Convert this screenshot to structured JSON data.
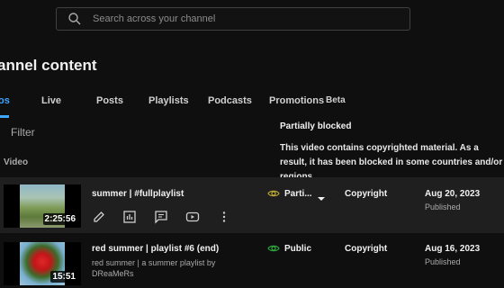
{
  "search": {
    "placeholder": "Search across your channel"
  },
  "page": {
    "title": "annel content"
  },
  "tabs": [
    {
      "label": "os"
    },
    {
      "label": "Live"
    },
    {
      "label": "Posts"
    },
    {
      "label": "Playlists"
    },
    {
      "label": "Podcasts"
    },
    {
      "label": "Promotions"
    }
  ],
  "beta_badge": "Beta",
  "filter": {
    "label": "Filter"
  },
  "columns": {
    "video": "Video"
  },
  "tooltip": {
    "title": "Partially blocked",
    "body": "This video contains copyrighted material. As a result, it has been blocked in some countries and/or regions."
  },
  "rows": [
    {
      "title": "summer | #fullplaylist",
      "duration": "2:25:56",
      "visibility": "Parti...",
      "restriction": "Copyright",
      "date": "Aug 20, 2023",
      "date_status": "Published",
      "visibility_icon": "eye-icon",
      "visibility_color": "#b8a633"
    },
    {
      "title": "red summer | playlist #6 (end)",
      "description": "red summer | a summer playlist by DReaMeRs —————————————————————/——",
      "duration": "15:51",
      "visibility": "Public",
      "restriction": "Copyright",
      "date": "Aug 16, 2023",
      "date_status": "Published",
      "visibility_icon": "eye-icon",
      "visibility_color": "#2ba640"
    }
  ],
  "row_actions": [
    "edit-icon",
    "analytics-icon",
    "comments-icon",
    "youtube-icon",
    "more-options-icon"
  ],
  "colors": {
    "accent": "#3ea6ff",
    "background": "#0f0f0f",
    "row_highlight": "#1f1f1f"
  }
}
